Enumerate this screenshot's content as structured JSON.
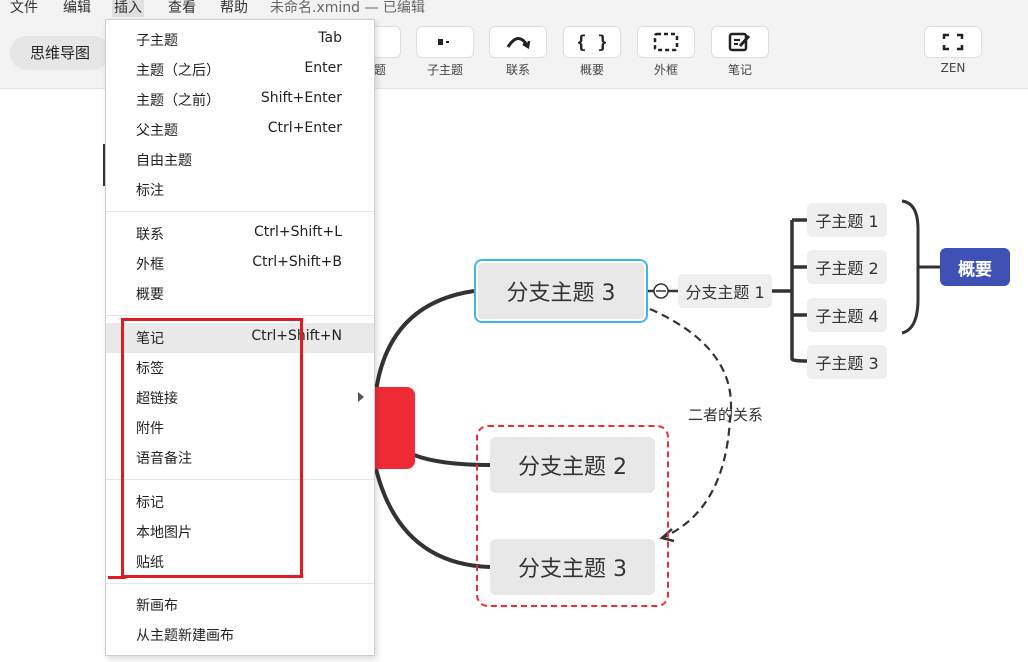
{
  "menubar": {
    "items": [
      "文件",
      "编辑",
      "插入",
      "查看",
      "帮助"
    ],
    "document_title": "未命名.xmind — 已编辑"
  },
  "toolbar": {
    "mode_button": "思维导图",
    "partial_label": "题",
    "buttons": [
      {
        "label": "子主题",
        "icon": "subtopic-icon"
      },
      {
        "label": "联系",
        "icon": "relationship-icon"
      },
      {
        "label": "概要",
        "icon": "summary-braces-icon"
      },
      {
        "label": "外框",
        "icon": "boundary-dashed-icon"
      },
      {
        "label": "笔记",
        "icon": "note-edit-icon"
      },
      {
        "label": "ZEN",
        "icon": "zen-fullscreen-icon"
      }
    ]
  },
  "insert_menu": {
    "groups": [
      [
        {
          "label": "子主题",
          "shortcut": "Tab"
        },
        {
          "label": "主题（之后）",
          "shortcut": "Enter"
        },
        {
          "label": "主题（之前）",
          "shortcut": "Shift+Enter"
        },
        {
          "label": "父主题",
          "shortcut": "Ctrl+Enter"
        },
        {
          "label": "自由主题",
          "shortcut": ""
        },
        {
          "label": "标注",
          "shortcut": ""
        }
      ],
      [
        {
          "label": "联系",
          "shortcut": "Ctrl+Shift+L"
        },
        {
          "label": "外框",
          "shortcut": "Ctrl+Shift+B"
        },
        {
          "label": "概要",
          "shortcut": ""
        }
      ],
      [
        {
          "label": "笔记",
          "shortcut": "Ctrl+Shift+N"
        },
        {
          "label": "标签",
          "shortcut": ""
        },
        {
          "label": "超链接",
          "shortcut": ""
        },
        {
          "label": "附件",
          "shortcut": ""
        },
        {
          "label": "语音备注",
          "shortcut": ""
        }
      ],
      [
        {
          "label": "标记",
          "shortcut": ""
        },
        {
          "label": "本地图片",
          "shortcut": ""
        },
        {
          "label": "贴纸",
          "shortcut": ""
        }
      ],
      [
        {
          "label": "新画布",
          "shortcut": ""
        },
        {
          "label": "从主题新建画布",
          "shortcut": ""
        }
      ]
    ],
    "highlighted": "笔记",
    "submenu_item": "超链接"
  },
  "mindmap": {
    "branches": [
      "分支主题 3",
      "分支主题 2",
      "分支主题 3"
    ],
    "selected_branch": "分支主题 3",
    "subtopic_of_selected": "分支主题 1",
    "subtopics": [
      "子主题 1",
      "子主题 2",
      "子主题 4",
      "子主题 3"
    ],
    "summary": "概要",
    "relationship_label": "二者的关系",
    "colors": {
      "central": "#ef2b35",
      "selection": "#3fb6ea",
      "summary": "#3f51b5",
      "boundary": "#ef2b35",
      "annotation": "#e11b22"
    }
  }
}
